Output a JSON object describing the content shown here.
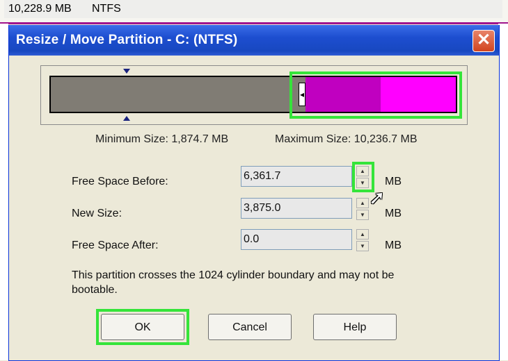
{
  "background": {
    "size_cell": "10,228.9 MB",
    "fs_cell": "NTFS"
  },
  "dialog": {
    "title": "Resize / Move Partition - C:  (NTFS)",
    "close_glyph": "✕",
    "min_size": "Minimum Size:  1,874.7 MB",
    "max_size": "Maximum Size:  10,236.7 MB"
  },
  "fields": {
    "free_before_label": "Free Space Before:",
    "free_before_value": "6,361.7",
    "new_size_label": "New Size:",
    "new_size_value": "3,875.0",
    "free_after_label": "Free Space After:",
    "free_after_value": "0.0",
    "unit": "MB"
  },
  "note": "This partition crosses the 1024 cylinder boundary and may not be bootable.",
  "buttons": {
    "ok": "OK",
    "cancel": "Cancel",
    "help": "Help"
  },
  "colors": {
    "highlight": "#35e43a",
    "partition_used": "#c000c0",
    "partition_free": "#ff00ff",
    "unallocated": "#807c74"
  }
}
